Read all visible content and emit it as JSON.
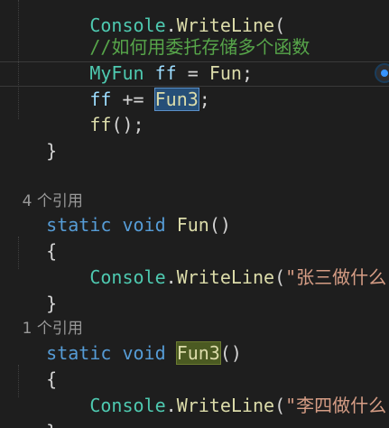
{
  "code": {
    "line0": {
      "a": "    ",
      "b": "Console",
      "c": ".",
      "d": "WriteLine",
      "e": "("
    },
    "line1": {
      "a": "    ",
      "comment": "//如何用委托存储多个函数"
    },
    "line2": {
      "a": "    ",
      "type": "MyFun",
      "sp1": " ",
      "var": "ff",
      "rest": " = ",
      "method": "Fun",
      "end": ";"
    },
    "line3": {
      "a": "    ",
      "var": "ff",
      "op": " += ",
      "sel": "Fun3",
      "end": ";"
    },
    "line4": {
      "a": "    ",
      "method": "ff",
      "end": "();"
    },
    "line5": {
      "text": "}"
    },
    "lens1": "4 个引用",
    "line7": {
      "kw1": "static",
      "sp": " ",
      "kw2": "void",
      "sp2": " ",
      "method": "Fun",
      "end": "()"
    },
    "line8": {
      "text": "{"
    },
    "line9": {
      "a": "    ",
      "type": "Console",
      "dot": ".",
      "method": "WriteLine",
      "open": "(",
      "str": "\"张三做什么\"",
      "end": ");"
    },
    "line10": {
      "text": "}"
    },
    "lens2": "1 个引用",
    "line12": {
      "kw1": "static",
      "sp": " ",
      "kw2": "void",
      "sp2": " ",
      "method": "Fun3",
      "end": "()"
    },
    "line13": {
      "text": "{"
    },
    "line14": {
      "a": "    ",
      "type": "Console",
      "dot": ".",
      "method": "WriteLine",
      "open": "(",
      "str": "\"李四做什么\"",
      "end": ");"
    },
    "line15": {
      "text": "}"
    }
  },
  "colors": {
    "background": "#1e1e1e",
    "keyword": "#569cd6",
    "type": "#4ec9b0",
    "method": "#dcdcaa",
    "string": "#d69d85",
    "comment": "#57a64a",
    "variable": "#9cdcfe"
  },
  "icons": {
    "quick_action": "lightbulb-icon"
  }
}
